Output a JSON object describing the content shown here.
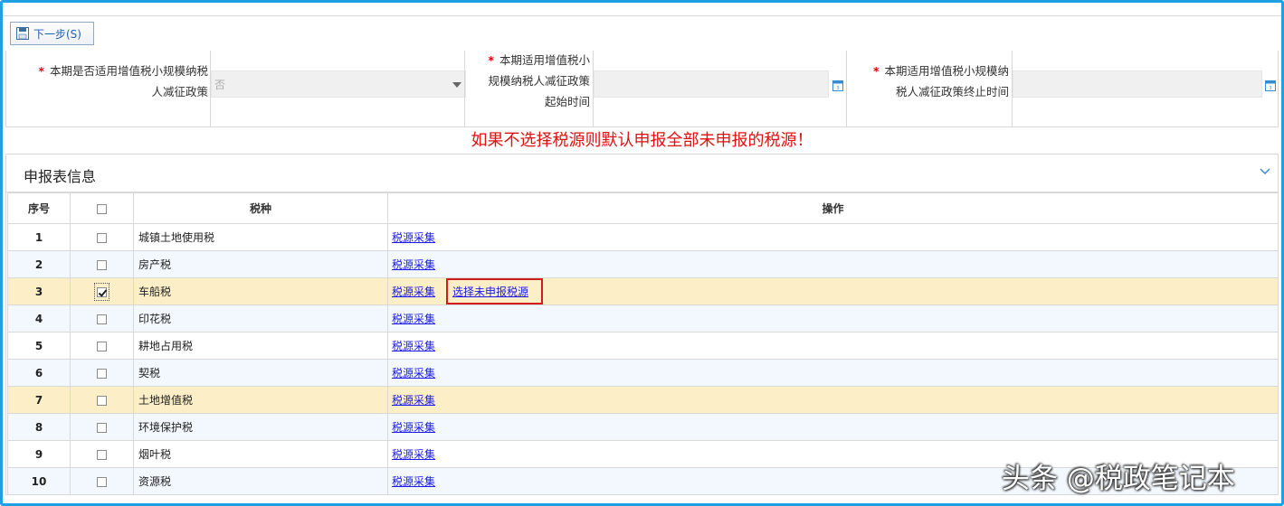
{
  "toolbar": {
    "next_label": "下一步(S)"
  },
  "form": {
    "field1": {
      "label_line1": "本期是否适用增值税小规模纳税",
      "label_line2": "人减征政策",
      "value": "否"
    },
    "field2": {
      "label_line1": "本期适用增值税小",
      "label_line2": "规模纳税人减征政策",
      "label_line3": "起始时间"
    },
    "field3": {
      "label_line1": "本期适用增值税小规模纳",
      "label_line2": "税人减征政策终止时间"
    },
    "required_mark": "*"
  },
  "notice": "如果不选择税源则默认申报全部未申报的税源！",
  "panel": {
    "title": "申报表信息",
    "columns": {
      "no": "序号",
      "tax": "税种",
      "ops": "操作"
    },
    "op_collect": "税源采集",
    "op_select": "选择未申报税源",
    "rows": [
      {
        "no": "1",
        "name": "城镇土地使用税",
        "checked": false
      },
      {
        "no": "2",
        "name": "房产税",
        "checked": false
      },
      {
        "no": "3",
        "name": "车船税",
        "checked": true
      },
      {
        "no": "4",
        "name": "印花税",
        "checked": false
      },
      {
        "no": "5",
        "name": "耕地占用税",
        "checked": false
      },
      {
        "no": "6",
        "name": "契税",
        "checked": false
      },
      {
        "no": "7",
        "name": "土地增值税",
        "checked": false
      },
      {
        "no": "8",
        "name": "环境保护税",
        "checked": false
      },
      {
        "no": "9",
        "name": "烟叶税",
        "checked": false
      },
      {
        "no": "10",
        "name": "资源税",
        "checked": false
      }
    ]
  },
  "watermark": "头条 @税政笔记本",
  "colors": {
    "frame": "#1fa0e0",
    "notice": "#e01010",
    "highlight_row": "#fcefc7",
    "alt_row": "#f2f8fd",
    "link": "#1a1aee"
  }
}
